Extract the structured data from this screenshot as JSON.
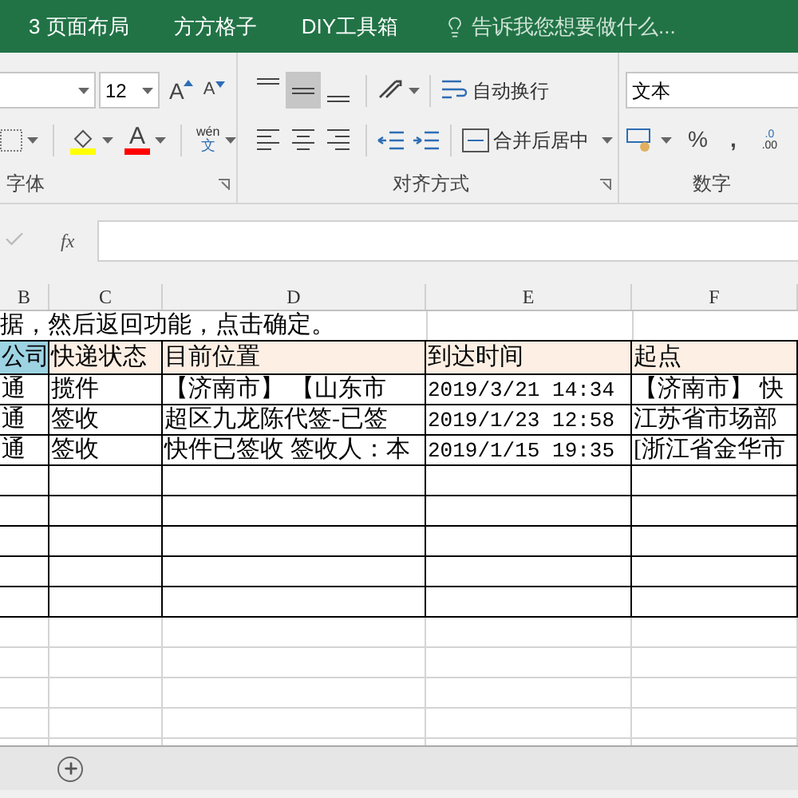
{
  "ribbon": {
    "tabs": [
      {
        "label": "3 页面布局"
      },
      {
        "label": "方方格子"
      },
      {
        "label": "DIY工具箱"
      }
    ],
    "tell_me": "告诉我您想要做什么..."
  },
  "font_group": {
    "font_size": "12",
    "grow": "A",
    "shrink": "A",
    "font_color_letter": "A",
    "phonetic_top": "wén",
    "phonetic_bottom": "文",
    "label": "字体"
  },
  "alignment_group": {
    "vertical": [
      {
        "selected": false
      },
      {
        "selected": true
      },
      {
        "selected": false
      }
    ],
    "wrap_text": "自动换行",
    "merge": "合并后居中",
    "label": "对齐方式"
  },
  "number_group": {
    "format": "文本",
    "percent": "%",
    "comma": ",",
    "decimal_top": ".0",
    "decimal_bottom": ".00",
    "label": "数字"
  },
  "formula_bar": {
    "fx": "fx"
  },
  "sheet": {
    "columns": [
      "B",
      "C",
      "D",
      "E",
      "F"
    ],
    "note": "据，然后返回功能，点击确定。",
    "header_row": [
      {
        "text": "公司",
        "color": "#9dd3e3"
      },
      {
        "text": "快递状态",
        "color": "#fdefe4"
      },
      {
        "text": "目前位置",
        "color": "#fdefe4"
      },
      {
        "text": "到达时间",
        "color": "#fdefe4"
      },
      {
        "text": "起点",
        "color": "#fdefe4"
      }
    ],
    "rows": [
      [
        "通",
        "揽件",
        "【济南市】 【山东市",
        "2019/3/21 14:34",
        "【济南市】 快"
      ],
      [
        "通",
        "签收",
        "超区九龙陈代签-已签",
        "2019/1/23 12:58",
        "江苏省市场部"
      ],
      [
        "通",
        "签收",
        "快件已签收 签收人：本",
        "2019/1/15 19:35",
        "[浙江省金华市"
      ]
    ]
  }
}
